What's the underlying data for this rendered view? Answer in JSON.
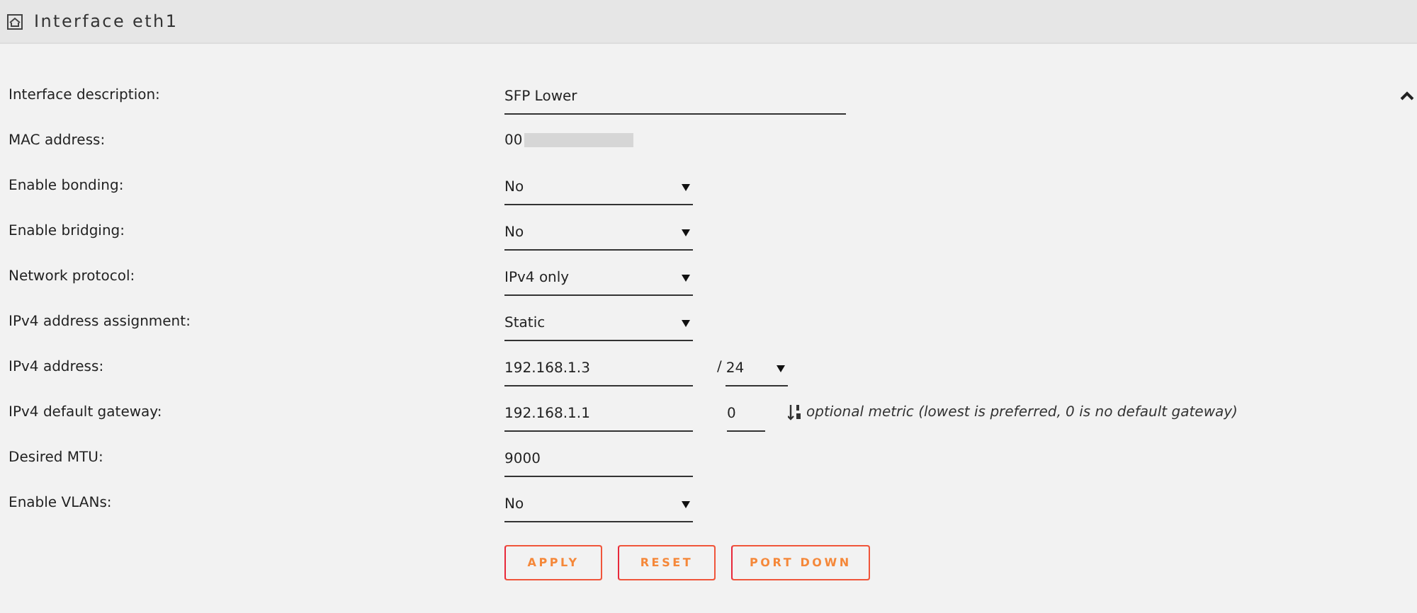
{
  "header": {
    "title": "Interface eth1"
  },
  "rows": [
    {
      "kind": "text",
      "label": "Interface description:",
      "value": "SFP Lower"
    },
    {
      "kind": "static",
      "label": "MAC address:",
      "value": "00"
    },
    {
      "kind": "select",
      "label": "Enable bonding:",
      "value": "No"
    },
    {
      "kind": "select",
      "label": "Enable bridging:",
      "value": "No"
    },
    {
      "kind": "select",
      "label": "Network protocol:",
      "value": "IPv4 only"
    },
    {
      "kind": "select",
      "label": "IPv4 address assignment:",
      "value": "Static"
    },
    {
      "kind": "address",
      "label": "IPv4 address:",
      "value": "192.168.1.3",
      "prefix": "/ 24"
    },
    {
      "kind": "gateway",
      "label": "IPv4 default gateway:",
      "value": "192.168.1.1",
      "metric": "0",
      "hint": "optional metric (lowest is preferred, 0 is no default gateway)"
    },
    {
      "kind": "short",
      "label": "Desired MTU:",
      "value": "9000"
    },
    {
      "kind": "select",
      "label": "Enable VLANs:",
      "value": "No"
    }
  ],
  "buttons": [
    "APPLY",
    "RESET",
    "PORT DOWN"
  ]
}
